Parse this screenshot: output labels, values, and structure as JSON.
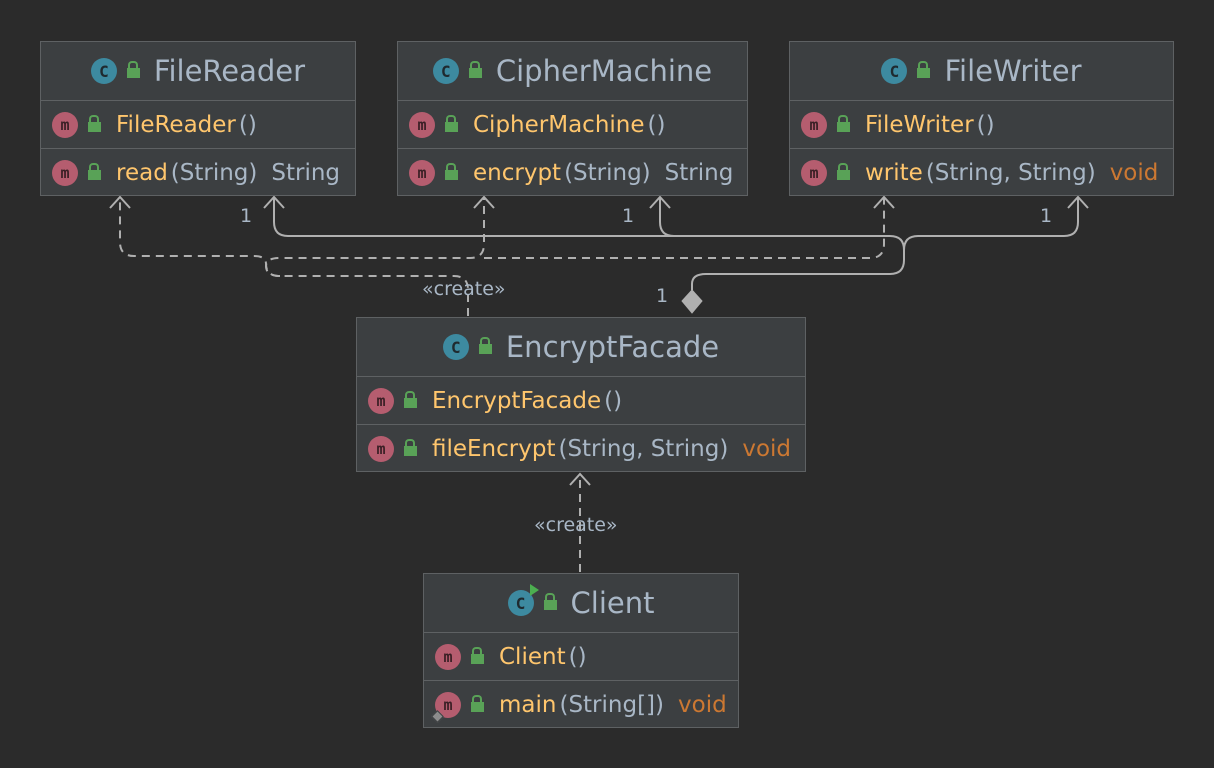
{
  "classes": {
    "file_reader": {
      "name": "FileReader",
      "members": [
        {
          "name": "FileReader",
          "params": "()",
          "ret": ""
        },
        {
          "name": "read",
          "params": "(String)",
          "ret": "String"
        }
      ]
    },
    "cipher_machine": {
      "name": "CipherMachine",
      "members": [
        {
          "name": "CipherMachine",
          "params": "()",
          "ret": ""
        },
        {
          "name": "encrypt",
          "params": "(String)",
          "ret": "String"
        }
      ]
    },
    "file_writer": {
      "name": "FileWriter",
      "members": [
        {
          "name": "FileWriter",
          "params": "()",
          "ret": ""
        },
        {
          "name": "write",
          "params": "(String, String)",
          "ret": "void"
        }
      ]
    },
    "encrypt_facade": {
      "name": "EncryptFacade",
      "members": [
        {
          "name": "EncryptFacade",
          "params": "()",
          "ret": ""
        },
        {
          "name": "fileEncrypt",
          "params": "(String, String)",
          "ret": "void"
        }
      ]
    },
    "client": {
      "name": "Client",
      "members": [
        {
          "name": "Client",
          "params": "()",
          "ret": ""
        },
        {
          "name": "main",
          "params": "(String[])",
          "ret": "void"
        }
      ]
    }
  },
  "badges": {
    "class": "C",
    "method": "m"
  },
  "labels": {
    "create_top": "«create»",
    "create_bottom": "«create»",
    "mult_reader": "1",
    "mult_cipher": "1",
    "mult_writer": "1",
    "mult_facade": "1"
  },
  "colors": {
    "background": "#2b2b2b",
    "box": "#3c3f41",
    "border": "#5e6163",
    "method_name": "#ffc66d",
    "keyword": "#cc7832",
    "text": "#a9b7c6",
    "class_badge": "#3d8aa0",
    "method_badge": "#b55d6f",
    "line": "#b0b0b0"
  }
}
